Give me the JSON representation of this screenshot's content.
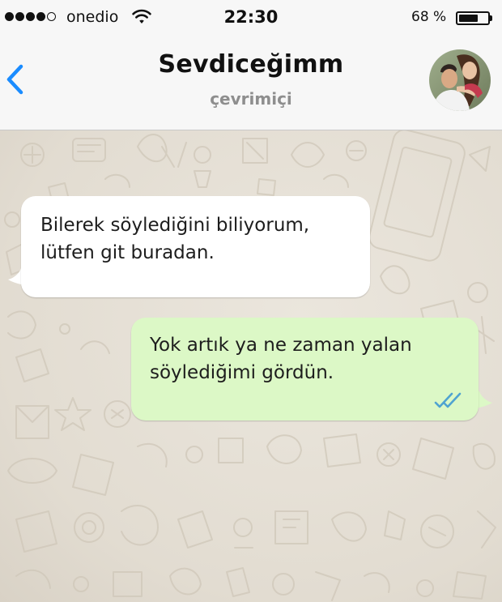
{
  "status_bar": {
    "carrier": "onedio",
    "time": "22:30",
    "battery_percent": "68 %",
    "battery_level": 0.68,
    "signal_bars_filled": 4,
    "signal_bars_total": 5
  },
  "header": {
    "contact_name": "Sevdiceğimm",
    "contact_status": "çevrimiçi",
    "back_icon": "chevron-left-icon",
    "accent_color": "#1a8cff"
  },
  "messages": [
    {
      "direction": "incoming",
      "lines": [
        "Bilerek söylediğini biliyorum,",
        "lütfen git buradan."
      ]
    },
    {
      "direction": "outgoing",
      "lines": [
        "Yok artık ya ne zaman yalan",
        "söylediğimi gördün."
      ],
      "status_icon": "double-check-icon",
      "status_color": "#4fa3d1"
    }
  ],
  "colors": {
    "incoming_bubble": "#ffffff",
    "outgoing_bubble": "#dcf8c6",
    "header_bg": "#f7f7f7",
    "chat_bg": "#e6e0d6"
  }
}
